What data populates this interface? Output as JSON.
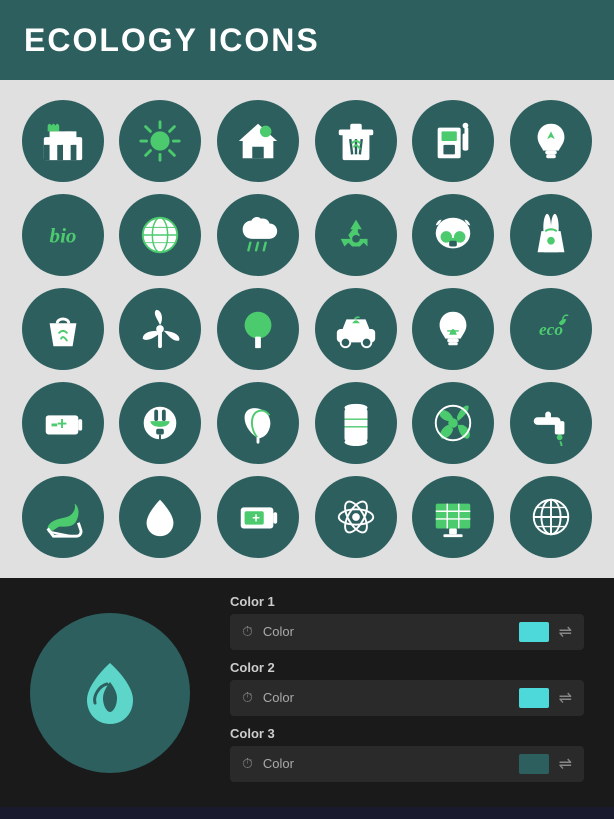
{
  "header": {
    "title": "ECOLOGY ICONS",
    "background": "#2d5f5f"
  },
  "icons": [
    {
      "id": "factory",
      "label": "Factory"
    },
    {
      "id": "sun",
      "label": "Sun"
    },
    {
      "id": "eco-home",
      "label": "Eco Home"
    },
    {
      "id": "recycle-bin",
      "label": "Recycle Bin"
    },
    {
      "id": "fuel-station",
      "label": "Fuel Station"
    },
    {
      "id": "eco-bulb",
      "label": "Eco Bulb"
    },
    {
      "id": "bio",
      "label": "Bio"
    },
    {
      "id": "globe",
      "label": "Globe"
    },
    {
      "id": "rain-cloud",
      "label": "Rain Cloud"
    },
    {
      "id": "recycle",
      "label": "Recycle"
    },
    {
      "id": "gas-mask",
      "label": "Gas Mask"
    },
    {
      "id": "nuclear-plant",
      "label": "Nuclear Plant"
    },
    {
      "id": "eco-bag",
      "label": "Eco Bag"
    },
    {
      "id": "wind-turbine",
      "label": "Wind Turbine"
    },
    {
      "id": "tree",
      "label": "Tree"
    },
    {
      "id": "eco-car",
      "label": "Eco Car"
    },
    {
      "id": "eco-bulb2",
      "label": "Eco Bulb 2"
    },
    {
      "id": "eco-text",
      "label": "Eco Text"
    },
    {
      "id": "battery",
      "label": "Battery"
    },
    {
      "id": "plug",
      "label": "Plug"
    },
    {
      "id": "leaf",
      "label": "Leaf"
    },
    {
      "id": "barrel",
      "label": "Barrel"
    },
    {
      "id": "radiation",
      "label": "Radiation"
    },
    {
      "id": "water-tap",
      "label": "Water Tap"
    },
    {
      "id": "hand-leaf",
      "label": "Hand Leaf"
    },
    {
      "id": "water-drop",
      "label": "Water Drop"
    },
    {
      "id": "green-battery",
      "label": "Green Battery"
    },
    {
      "id": "atom",
      "label": "Atom"
    },
    {
      "id": "solar-panel",
      "label": "Solar Panel"
    },
    {
      "id": "world-grid",
      "label": "World Grid"
    }
  ],
  "preview": {
    "label": "Preview Icon"
  },
  "color_controls": {
    "color1": {
      "label": "Color 1",
      "text": "Color",
      "swatch": "#4dd9d9"
    },
    "color2": {
      "label": "Color 2",
      "text": "Color",
      "swatch": "#4dd9d9"
    },
    "color3": {
      "label": "Color 3",
      "text": "Color",
      "swatch": "#2d5f5f"
    }
  }
}
